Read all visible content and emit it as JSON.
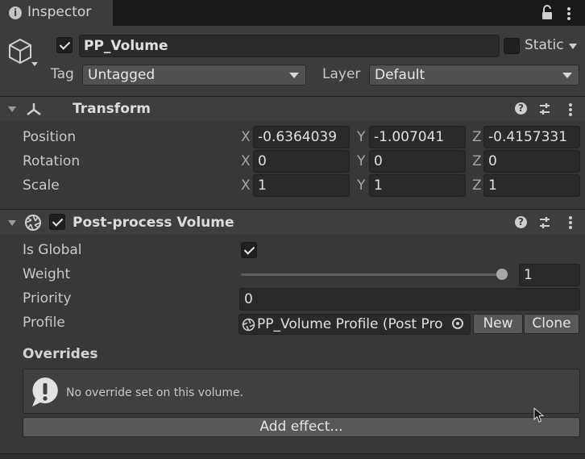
{
  "tab": {
    "title": "Inspector"
  },
  "object": {
    "name": "PP_Volume",
    "active": true,
    "static_label": "Static",
    "static_checked": false,
    "tag_label": "Tag",
    "tag_value": "Untagged",
    "layer_label": "Layer",
    "layer_value": "Default"
  },
  "transform": {
    "title": "Transform",
    "position_label": "Position",
    "rotation_label": "Rotation",
    "scale_label": "Scale",
    "axis_x": "X",
    "axis_y": "Y",
    "axis_z": "Z",
    "position": {
      "x": "-0.6364039",
      "y": "-1.007041",
      "z": "-0.4157331"
    },
    "rotation": {
      "x": "0",
      "y": "0",
      "z": "0"
    },
    "scale": {
      "x": "1",
      "y": "1",
      "z": "1"
    }
  },
  "ppvolume": {
    "title": "Post-process Volume",
    "enabled": true,
    "is_global_label": "Is Global",
    "is_global": true,
    "weight_label": "Weight",
    "weight_value": "1",
    "weight_fraction": 1.0,
    "priority_label": "Priority",
    "priority_value": "0",
    "profile_label": "Profile",
    "profile_value": "PP_Volume Profile (Post Pro",
    "new_button": "New",
    "clone_button": "Clone",
    "overrides_label": "Overrides",
    "no_override_text": "No override set on this volume.",
    "add_effect_button": "Add effect..."
  },
  "colors": {
    "background": "#383838",
    "header": "#3e3e3e",
    "field": "#2a2a2a",
    "text": "#d2d2d2"
  }
}
